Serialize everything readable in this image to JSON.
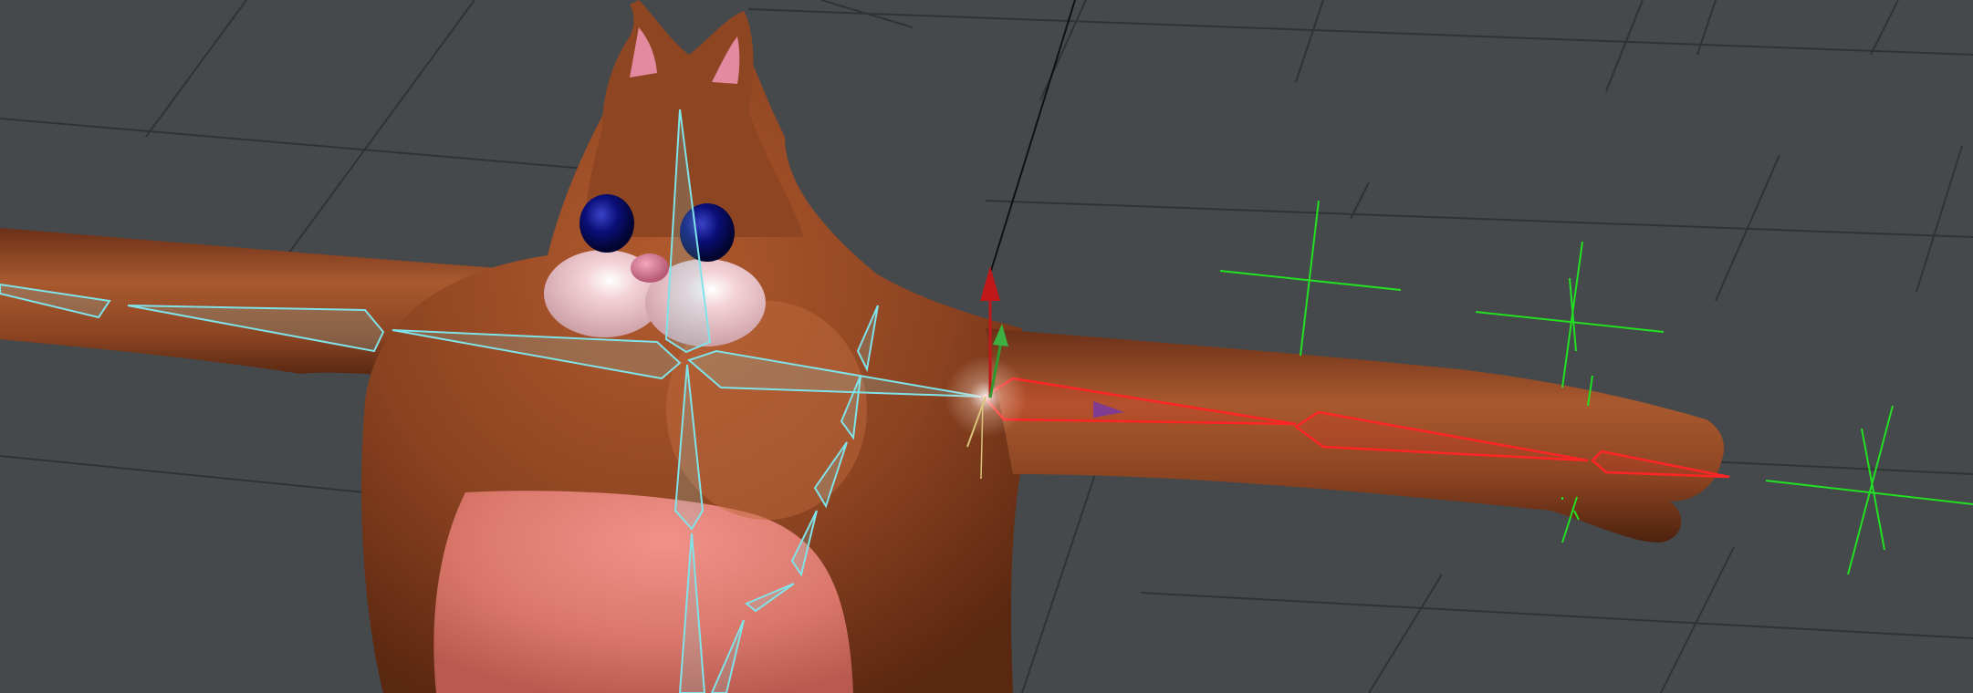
{
  "viewport": {
    "background": "#45494c",
    "grid_color": "#2f3336"
  },
  "model": {
    "name": "",
    "body_color": "#8a4220",
    "belly_color": "#d9776a",
    "ear_inner_color": "#e38aa0",
    "eye_color": "#0a0f78",
    "muzzle_color": "#f1c9cf",
    "nose_color": "#d2718e"
  },
  "rig": {
    "bone_color": "#7fe3e9",
    "selected_bone_color": "#ff2525",
    "locator_color": "#22e022",
    "gizmo": {
      "y_axis_color": "#c01818",
      "x_axis_color": "#d9c47a",
      "z_axis_color": "#2e9a2e"
    }
  }
}
